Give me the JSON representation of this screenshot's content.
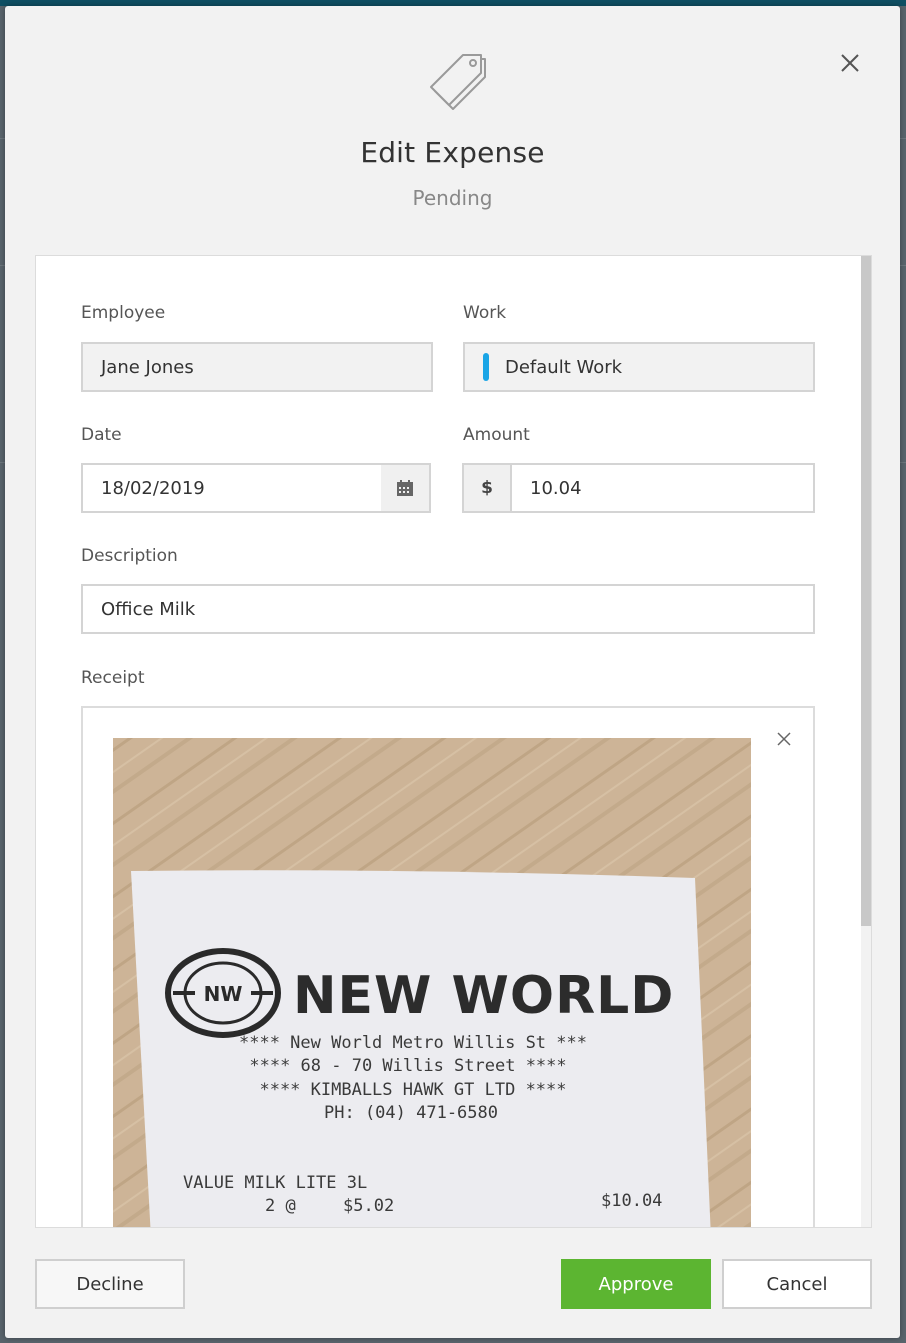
{
  "modal": {
    "title": "Edit Expense",
    "status": "Pending",
    "icon": "price-tag-icon"
  },
  "form": {
    "employee": {
      "label": "Employee",
      "value": "Jane Jones"
    },
    "work": {
      "label": "Work",
      "value": "Default Work",
      "color": "#1aa5e6"
    },
    "date": {
      "label": "Date",
      "value": "18/02/2019"
    },
    "amount": {
      "label": "Amount",
      "currency": "$",
      "value": "10.04"
    },
    "description": {
      "label": "Description",
      "value": "Office Milk"
    },
    "receipt": {
      "label": "Receipt",
      "image": {
        "store_name": "NEW WORLD",
        "logo_text": "NW",
        "lines": [
          "**** New World Metro Willis St ***",
          "**** 68 - 70 Willis Street ****",
          "**** KIMBALLS HAWK GT LTD ****",
          "PH: (04) 471-6580"
        ],
        "item_name": "VALUE MILK LITE 3L",
        "item_qty": "2 @",
        "item_unit_price": "$5.02",
        "item_total": "$10.04"
      }
    }
  },
  "footer": {
    "decline_label": "Decline",
    "approve_label": "Approve",
    "cancel_label": "Cancel"
  },
  "colors": {
    "accent_green": "#5cb531",
    "work_marker": "#1aa5e6"
  }
}
